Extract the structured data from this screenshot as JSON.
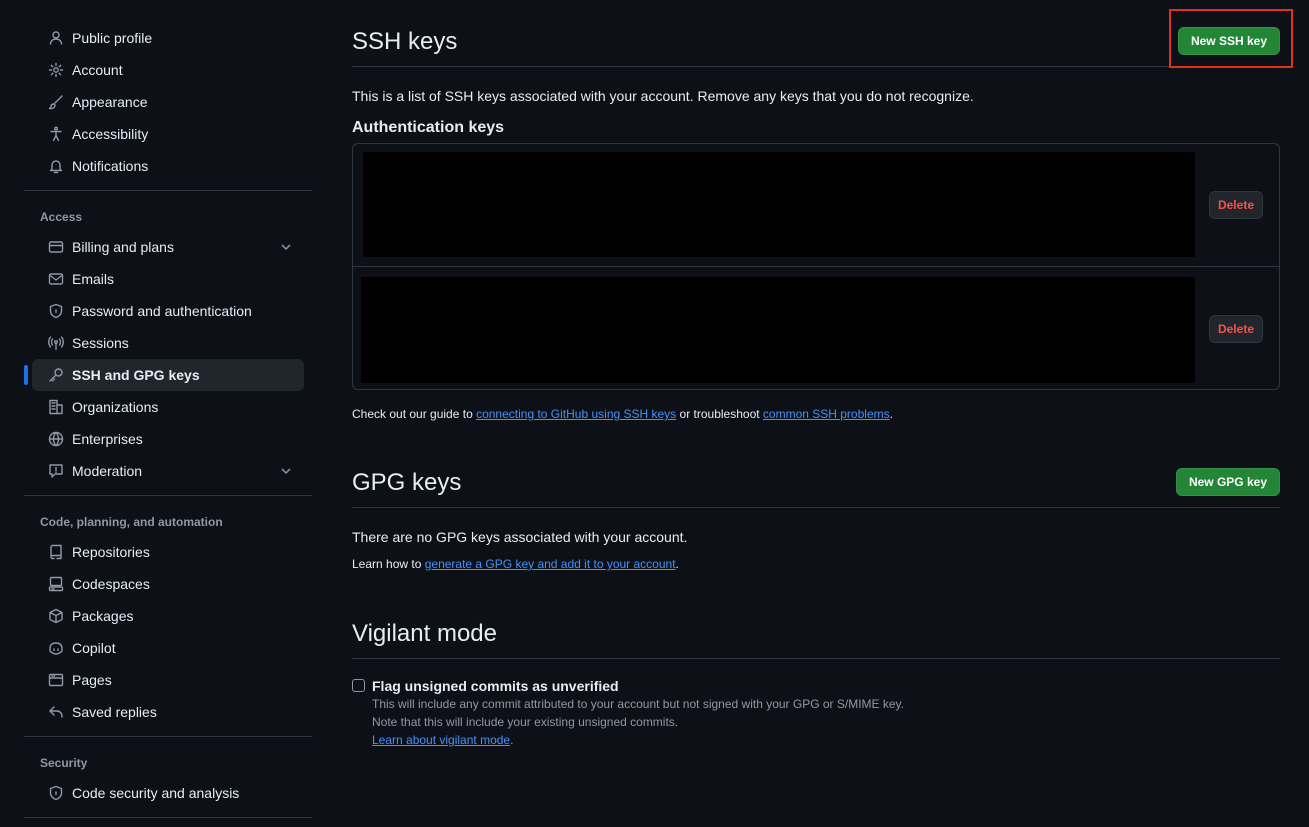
{
  "sidebar": {
    "top_items": [
      {
        "label": "Public profile",
        "icon": "person-icon"
      },
      {
        "label": "Account",
        "icon": "gear-icon"
      },
      {
        "label": "Appearance",
        "icon": "paintbrush-icon"
      },
      {
        "label": "Accessibility",
        "icon": "accessibility-icon"
      },
      {
        "label": "Notifications",
        "icon": "bell-icon"
      }
    ],
    "access_label": "Access",
    "access_items": [
      {
        "label": "Billing and plans",
        "icon": "credit-card-icon"
      },
      {
        "label": "Emails",
        "icon": "mail-icon"
      },
      {
        "label": "Password and authentication",
        "icon": "shield-lock-icon"
      },
      {
        "label": "Sessions",
        "icon": "broadcast-icon"
      },
      {
        "label": "SSH and GPG keys",
        "icon": "key-icon"
      },
      {
        "label": "Organizations",
        "icon": "organization-icon"
      },
      {
        "label": "Enterprises",
        "icon": "globe-icon"
      },
      {
        "label": "Moderation",
        "icon": "report-icon"
      }
    ],
    "code_label": "Code, planning, and automation",
    "code_items": [
      {
        "label": "Repositories",
        "icon": "repo-icon"
      },
      {
        "label": "Codespaces",
        "icon": "codespaces-icon"
      },
      {
        "label": "Packages",
        "icon": "package-icon"
      },
      {
        "label": "Copilot",
        "icon": "copilot-icon"
      },
      {
        "label": "Pages",
        "icon": "browser-icon"
      },
      {
        "label": "Saved replies",
        "icon": "reply-icon"
      }
    ],
    "security_label": "Security",
    "security_items": [
      {
        "label": "Code security and analysis",
        "icon": "shield-lock-icon"
      }
    ]
  },
  "ssh": {
    "title": "SSH keys",
    "new_button": "New SSH key",
    "description": "This is a list of SSH keys associated with your account. Remove any keys that you do not recognize.",
    "auth_heading": "Authentication keys",
    "delete_label": "Delete",
    "guide_prefix": "Check out our guide to ",
    "guide_link1": "connecting to GitHub using SSH keys",
    "guide_mid": " or troubleshoot ",
    "guide_link2": "common SSH problems",
    "guide_suffix": "."
  },
  "gpg": {
    "title": "GPG keys",
    "new_button": "New GPG key",
    "empty": "There are no GPG keys associated with your account.",
    "learn_prefix": "Learn how to ",
    "learn_link": "generate a GPG key and add it to your account",
    "learn_suffix": "."
  },
  "vigilant": {
    "title": "Vigilant mode",
    "checkbox_label": "Flag unsigned commits as unverified",
    "line1": "This will include any commit attributed to your account but not signed with your GPG or S/MIME key.",
    "line2": "Note that this will include your existing unsigned commits.",
    "learn_link": "Learn about vigilant mode",
    "learn_suffix": "."
  },
  "colors": {
    "accent": "#1f6feb",
    "green_button": "#238636",
    "danger": "#f85149",
    "link": "#4493f8",
    "highlight": "#e0311f"
  }
}
